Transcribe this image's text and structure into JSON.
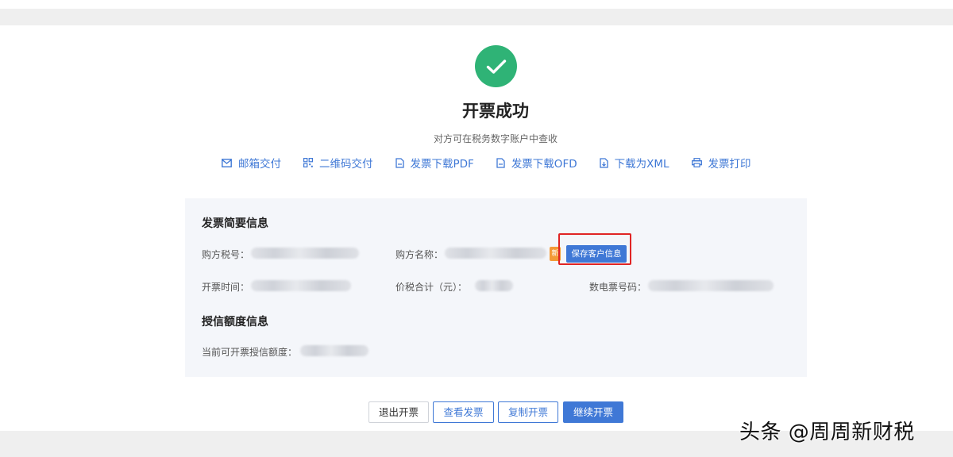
{
  "header": {
    "title": "开票成功",
    "subtitle": "对方可在税务数字账户中查收"
  },
  "actions": [
    {
      "label": "邮箱交付",
      "icon": "mail-icon"
    },
    {
      "label": "二维码交付",
      "icon": "qrcode-icon"
    },
    {
      "label": "发票下载PDF",
      "icon": "pdf-file-icon"
    },
    {
      "label": "发票下载OFD",
      "icon": "ofd-file-icon"
    },
    {
      "label": "下载为XML",
      "icon": "xml-file-icon"
    },
    {
      "label": "发票打印",
      "icon": "printer-icon"
    }
  ],
  "invoice_summary": {
    "title": "发票简要信息",
    "buyer_tax_id_label": "购方税号：",
    "buyer_name_label": "购方名称：",
    "new_tag": "新",
    "save_customer_button": "保存客户信息",
    "issue_time_label": "开票时间：",
    "total_with_tax_label": "价税合计（元）：",
    "e_invoice_number_label": "数电票号码："
  },
  "credit_info": {
    "title": "授信额度信息",
    "available_quota_label": "当前可开票授信额度："
  },
  "footer_buttons": {
    "exit": "退出开票",
    "view": "查看发票",
    "copy": "复制开票",
    "continue": "继续开票"
  },
  "watermark": "头条 @周周新财税",
  "colors": {
    "success": "#2fb376",
    "primary": "#3f78d6",
    "highlight": "#e02424",
    "tag": "#f39a36"
  }
}
